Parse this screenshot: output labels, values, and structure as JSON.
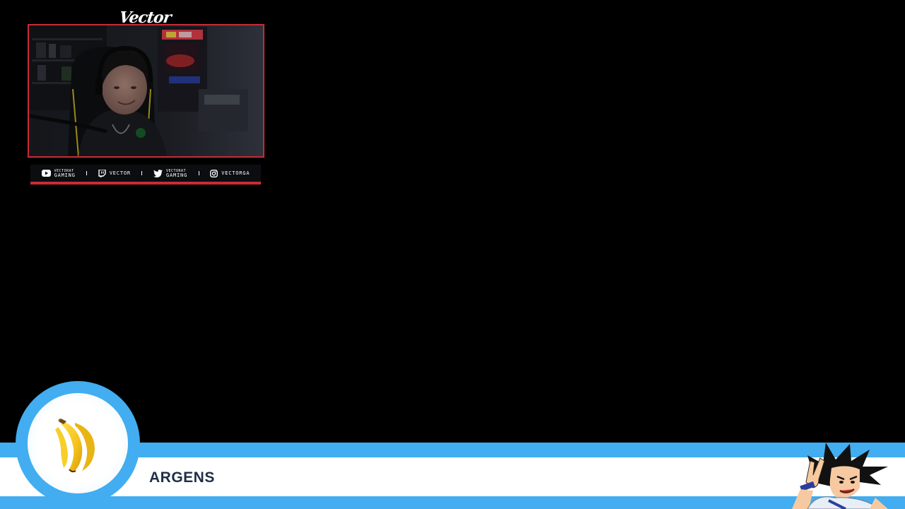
{
  "overlay": {
    "streamer_name": "Vector",
    "webcam_icon": "webcam-feed",
    "accent_color": "#c92b35",
    "banner_color": "#42adf0"
  },
  "social": {
    "youtube": {
      "icon": "youtube-icon",
      "line1": "VECTORAT",
      "line2": "GAMING"
    },
    "twitch": {
      "icon": "twitch-icon",
      "label": "VECTOR"
    },
    "twitter": {
      "icon": "twitter-icon",
      "line1": "VECTORAT",
      "line2": "GAMING"
    },
    "instagram": {
      "icon": "instagram-icon",
      "label": "VECTORGA"
    }
  },
  "banner": {
    "title": "ARGENS",
    "badge_icon": "banana-icon",
    "character_icon": "character-art"
  }
}
